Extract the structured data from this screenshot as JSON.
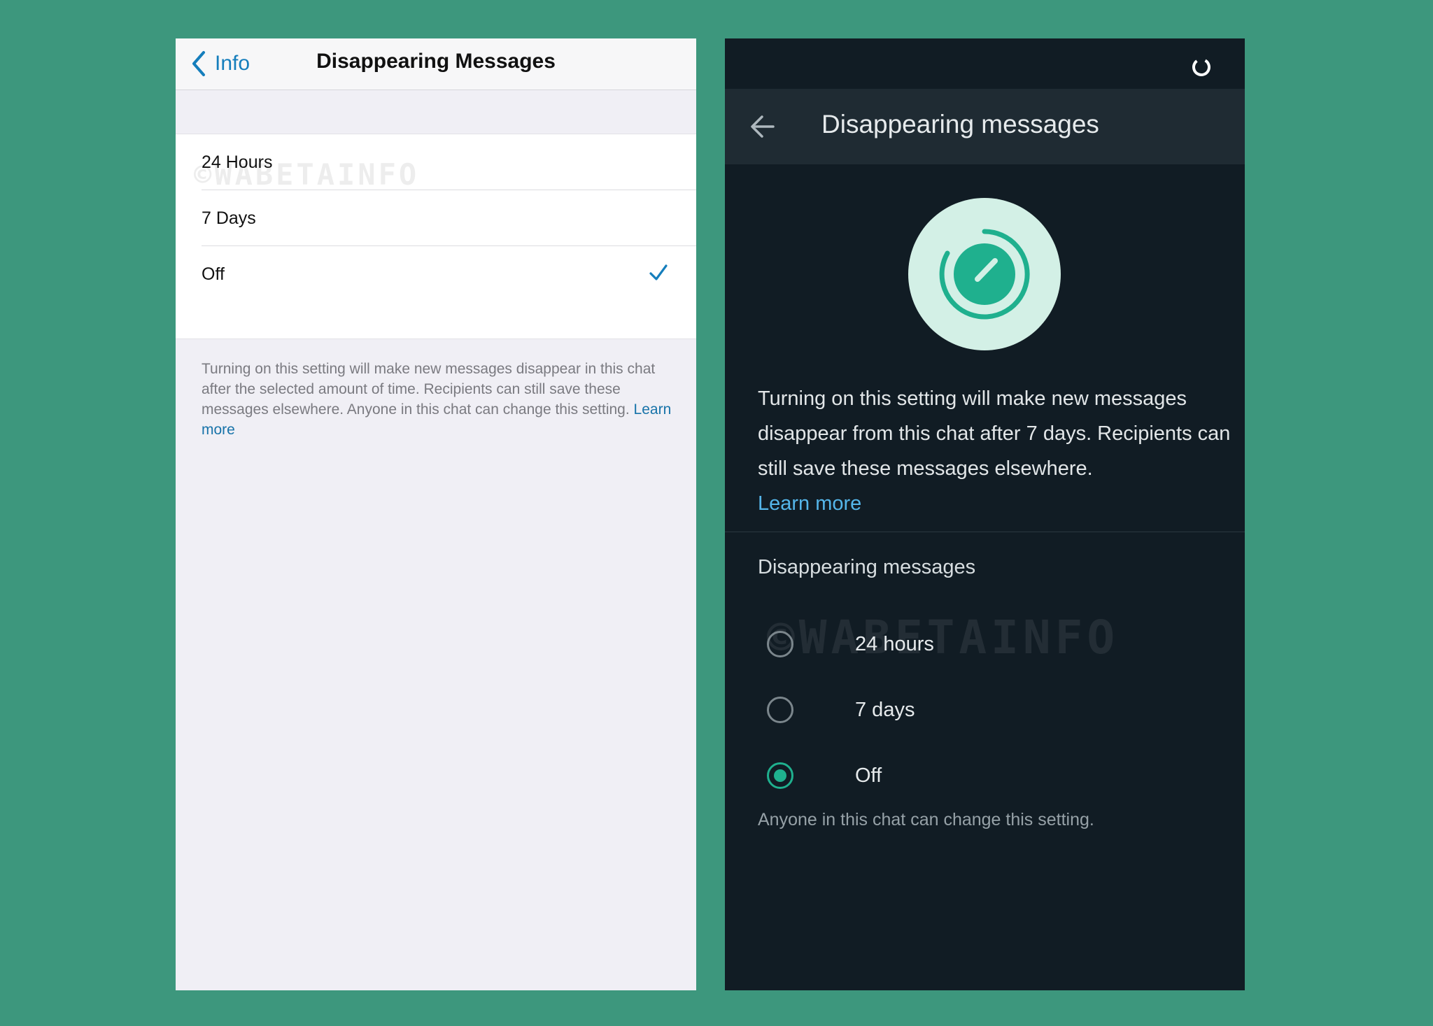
{
  "ios": {
    "back_label": "Info",
    "title": "Disappearing Messages",
    "options": [
      {
        "label": "24 Hours",
        "selected": false
      },
      {
        "label": "7 Days",
        "selected": false
      },
      {
        "label": "Off",
        "selected": true
      }
    ],
    "footer_text": "Turning on this setting will make new messages disappear in this chat after the selected amount of time. Recipients can still save these messages elsewhere. Anyone in this chat can change this setting.",
    "footer_link": "Learn more",
    "watermark": "©WABETAINFO",
    "accent_color": "#157ebc"
  },
  "android": {
    "title": "Disappearing messages",
    "description": "Turning on this setting will make new messages disappear from this chat after 7 days. Recipients can still save these messages elsewhere.",
    "description_link": "Learn more",
    "section_label": "Disappearing messages",
    "options": [
      {
        "label": "24 hours",
        "selected": false
      },
      {
        "label": "7 days",
        "selected": false
      },
      {
        "label": "Off",
        "selected": true
      }
    ],
    "note": "Anyone in this chat can change this setting.",
    "watermark": "©WABETAINFO",
    "accent_color": "#1fb08e",
    "icons": [
      "back-arrow-icon",
      "loading-spinner-icon",
      "timer-icon"
    ]
  }
}
